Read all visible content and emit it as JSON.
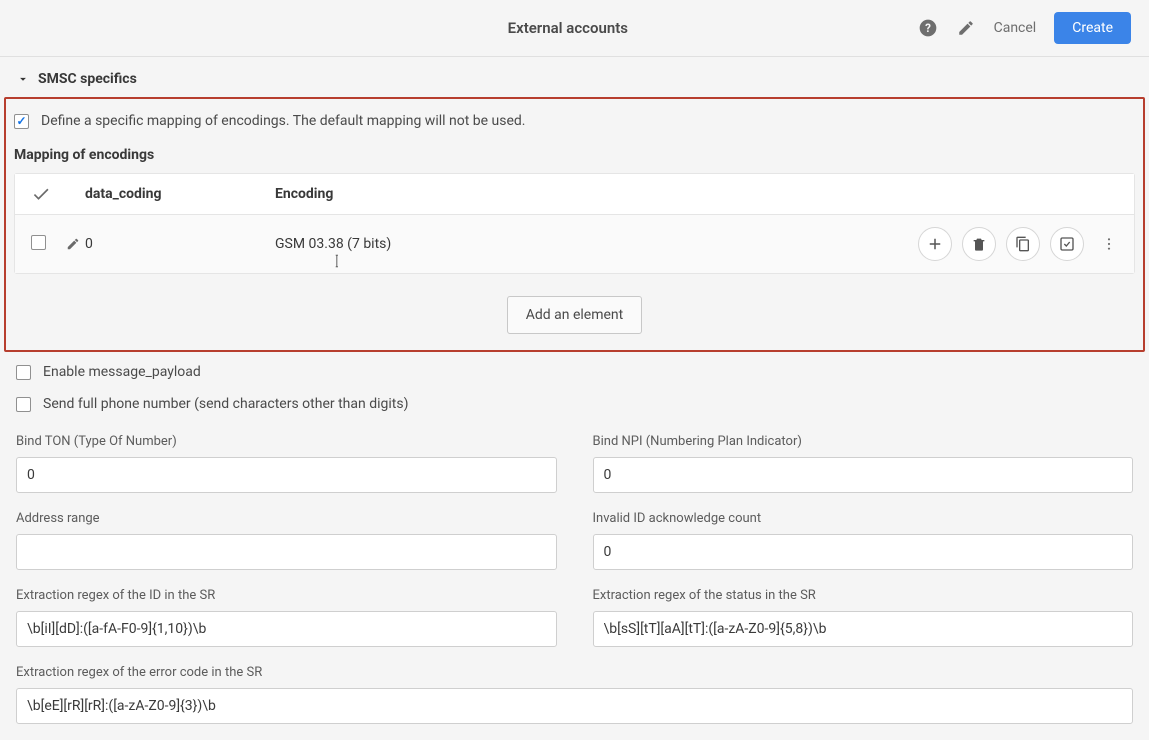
{
  "header": {
    "title": "External accounts",
    "cancel": "Cancel",
    "create": "Create"
  },
  "section": {
    "title": "SMSC specifics"
  },
  "mapping": {
    "define_label": "Define a specific mapping of encodings. The default mapping will not be used.",
    "subhead": "Mapping of encodings",
    "col_data": "data_coding",
    "col_enc": "Encoding",
    "row": {
      "data_coding": "0",
      "encoding": "GSM 03.38 (7 bits)"
    },
    "add_button": "Add an element"
  },
  "options": {
    "enable_payload": "Enable message_payload",
    "send_full_phone": "Send full phone number (send characters other than digits)"
  },
  "fields": {
    "bind_ton": {
      "label": "Bind TON (Type Of Number)",
      "value": "0"
    },
    "bind_npi": {
      "label": "Bind NPI (Numbering Plan Indicator)",
      "value": "0"
    },
    "address_range": {
      "label": "Address range",
      "value": ""
    },
    "invalid_ack": {
      "label": "Invalid ID acknowledge count",
      "value": "0"
    },
    "regex_id": {
      "label": "Extraction regex of the ID in the SR",
      "value": "\\b[iI][dD]:([a-fA-F0-9]{1,10})\\b"
    },
    "regex_status": {
      "label": "Extraction regex of the status in the SR",
      "value": "\\b[sS][tT][aA][tT]:([a-zA-Z0-9]{5,8})\\b"
    },
    "regex_err": {
      "label": "Extraction regex of the error code in the SR",
      "value": "\\b[eE][rR][rR]:([a-zA-Z0-9]{3})\\b"
    }
  }
}
